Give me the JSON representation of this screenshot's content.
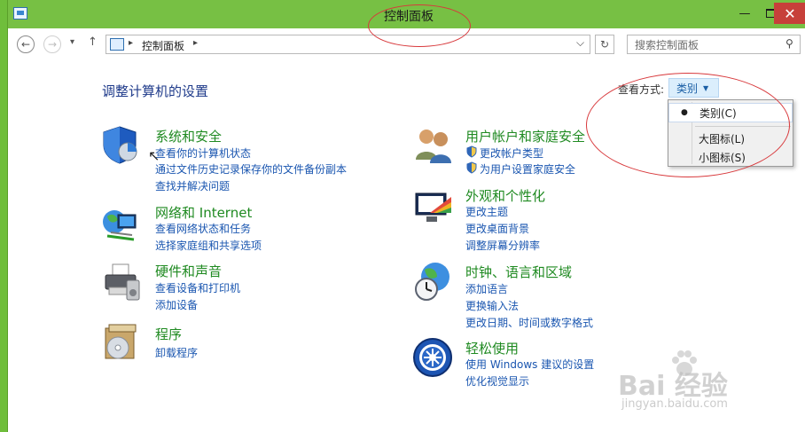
{
  "window": {
    "title": "控制面板",
    "min_glyph": "—",
    "close_glyph": "✕"
  },
  "nav": {
    "back_glyph": "←",
    "forward_glyph": "→",
    "recent_glyph": "▾",
    "up_glyph": "↑",
    "breadcrumb": "控制面板",
    "breadcrumb_sep": "▸",
    "address_dropdown_glyph": "⌵",
    "refresh_glyph": "↻",
    "search_placeholder": "搜索控制面板",
    "search_glyph": "⚲"
  },
  "main": {
    "heading": "调整计算机的设置",
    "view_by_label": "查看方式:",
    "view_by_value": "类别",
    "view_by_menu": [
      {
        "label": "类别(C)",
        "selected": true
      },
      {
        "label": "大图标(L)",
        "selected": false
      },
      {
        "label": "小图标(S)",
        "selected": false
      }
    ],
    "menu_bullet": "●"
  },
  "categories_left": [
    {
      "title": "系统和安全",
      "links": [
        "查看你的计算机状态",
        "通过文件历史记录保存你的文件备份副本",
        "查找并解决问题"
      ],
      "icon": "shield-icon"
    },
    {
      "title": "网络和 Internet",
      "links": [
        "查看网络状态和任务",
        "选择家庭组和共享选项"
      ],
      "icon": "network-globe-icon"
    },
    {
      "title": "硬件和声音",
      "links": [
        "查看设备和打印机",
        "添加设备"
      ],
      "icon": "printer-icon"
    },
    {
      "title": "程序",
      "links": [
        "卸载程序"
      ],
      "icon": "programs-disc-icon"
    }
  ],
  "categories_right": [
    {
      "title": "用户帐户和家庭安全",
      "links": [
        "更改帐户类型",
        "为用户设置家庭安全"
      ],
      "icon": "users-icon"
    },
    {
      "title": "外观和个性化",
      "links": [
        "更改主题",
        "更改桌面背景",
        "调整屏幕分辨率"
      ],
      "icon": "monitor-palette-icon"
    },
    {
      "title": "时钟、语言和区域",
      "links": [
        "添加语言",
        "更换输入法",
        "更改日期、时间或数字格式"
      ],
      "icon": "clock-globe-icon"
    },
    {
      "title": "轻松使用",
      "links": [
        "使用 Windows 建议的设置",
        "优化视觉显示"
      ],
      "icon": "ease-of-access-icon"
    }
  ],
  "watermark": {
    "brand": "Bai 经验",
    "url": "jingyan.baidu.com"
  },
  "colors": {
    "titlebar": "#77c044",
    "category_title": "#1f8a21",
    "link": "#1a56b0",
    "annotation": "#d8393c"
  }
}
